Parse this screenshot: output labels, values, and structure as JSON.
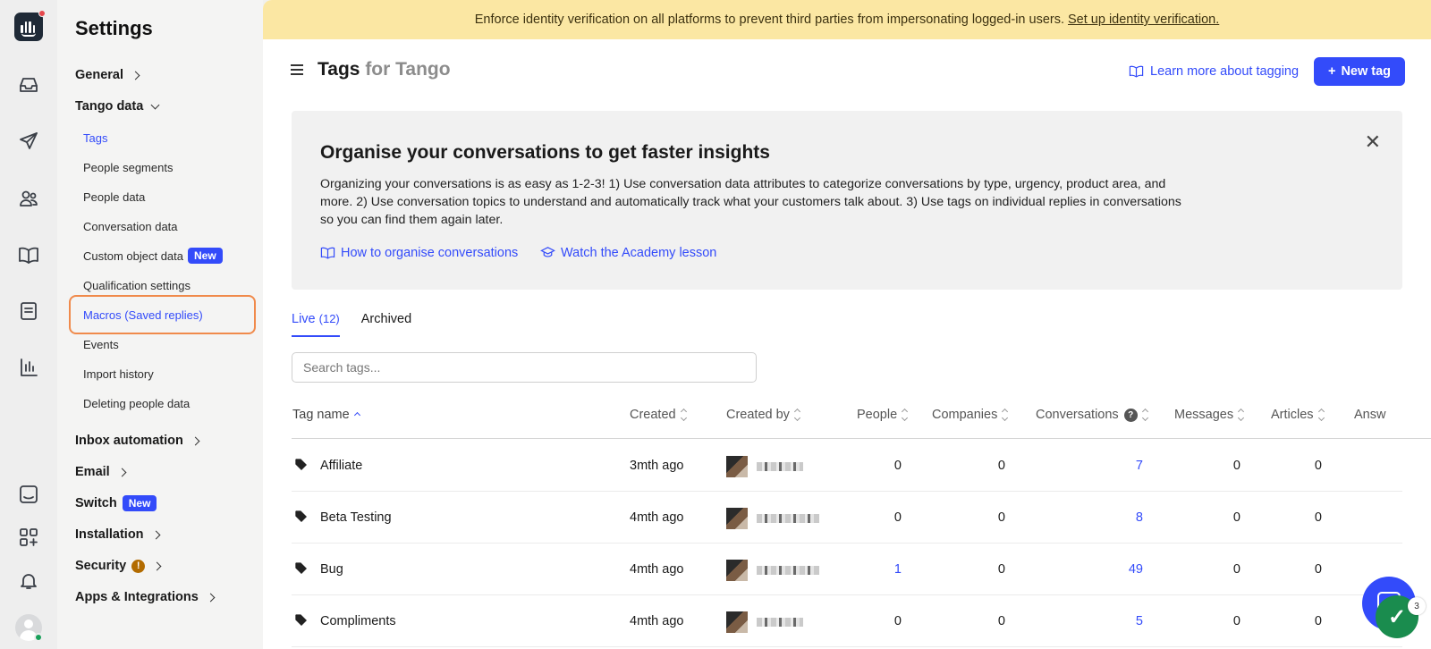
{
  "banner": {
    "text": "Enforce identity verification on all platforms to prevent third parties from impersonating logged-in users.",
    "link": "Set up identity verification."
  },
  "sidebar": {
    "title": "Settings",
    "sections": {
      "general": "General",
      "tango_data": "Tango data",
      "inbox_automation": "Inbox automation",
      "email": "Email",
      "switch": "Switch",
      "installation": "Installation",
      "security": "Security",
      "apps": "Apps & Integrations"
    },
    "items": [
      {
        "label": "Tags"
      },
      {
        "label": "People segments"
      },
      {
        "label": "People data"
      },
      {
        "label": "Conversation data"
      },
      {
        "label": "Custom object data"
      },
      {
        "label": "Qualification settings"
      },
      {
        "label": "Macros (Saved replies)"
      },
      {
        "label": "Events"
      },
      {
        "label": "Import history"
      },
      {
        "label": "Deleting people data"
      }
    ],
    "new_badge": "New",
    "warning_mark": "!"
  },
  "header": {
    "title": "Tags",
    "title_suffix": "for Tango",
    "learn_link": "Learn more about tagging",
    "new_tag_button": "New tag",
    "plus": "+"
  },
  "promo": {
    "heading": "Organise your conversations to get faster insights",
    "body": "Organizing your conversations is as easy as 1-2-3! 1) Use conversation data attributes to categorize conversations by type, urgency, product area, and more. 2) Use conversation topics to understand and automatically track what your customers talk about. 3) Use tags on individual replies in conversations so you can find them again later.",
    "link1": "How to organise conversations",
    "link2": "Watch the Academy lesson",
    "close": "✕"
  },
  "tabs": {
    "live": "Live",
    "live_count": "(12)",
    "archived": "Archived"
  },
  "search": {
    "placeholder": "Search tags..."
  },
  "table": {
    "headers": {
      "tag_name": "Tag name",
      "created": "Created",
      "created_by": "Created by",
      "people": "People",
      "companies": "Companies",
      "conversations": "Conversations",
      "messages": "Messages",
      "articles": "Articles",
      "answers": "Answ"
    },
    "help_mark": "?",
    "rows": [
      {
        "name": "Affiliate",
        "created": "3mth ago",
        "people": "0",
        "companies": "0",
        "conversations": "7",
        "messages": "0",
        "articles": "0"
      },
      {
        "name": "Beta Testing",
        "created": "4mth ago",
        "people": "0",
        "companies": "0",
        "conversations": "8",
        "messages": "0",
        "articles": "0"
      },
      {
        "name": "Bug",
        "created": "4mth ago",
        "people": "1",
        "companies": "0",
        "conversations": "49",
        "messages": "0",
        "articles": "0"
      },
      {
        "name": "Compliments",
        "created": "4mth ago",
        "people": "0",
        "companies": "0",
        "conversations": "5",
        "messages": "0",
        "articles": "0"
      }
    ]
  },
  "chat_widget": {
    "count": "3",
    "check": "✓"
  },
  "colors": {
    "accent": "#334bfa",
    "banner": "#fbe7a3",
    "highlight": "#f08a4b"
  }
}
